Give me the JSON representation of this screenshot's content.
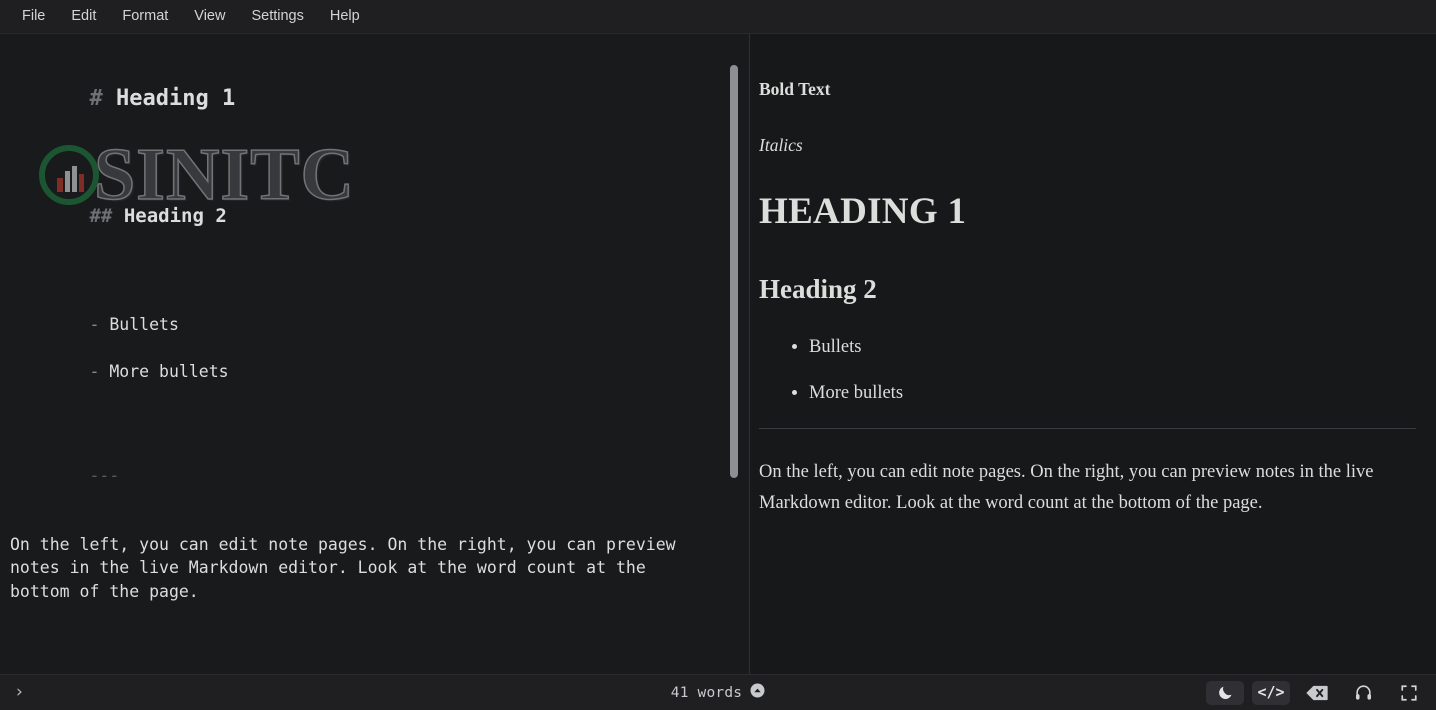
{
  "menubar": {
    "items": [
      {
        "label": "File",
        "name": "menu-file"
      },
      {
        "label": "Edit",
        "name": "menu-edit"
      },
      {
        "label": "Format",
        "name": "menu-format"
      },
      {
        "label": "View",
        "name": "menu-view"
      },
      {
        "label": "Settings",
        "name": "menu-settings"
      },
      {
        "label": "Help",
        "name": "menu-help"
      }
    ]
  },
  "editor": {
    "h1_mark": "#",
    "h1_text": "Heading 1",
    "h2_mark": "##",
    "h2_text": "Heading 2",
    "bullet_mark_1": "-",
    "bullet_text_1": "Bullets",
    "bullet_mark_2": "-",
    "bullet_text_2": "More bullets",
    "hr": "---",
    "paragraph": "On the left, you can edit note pages. On the right, you can preview notes in the live Markdown editor. Look at the word count at the bottom of the page."
  },
  "preview": {
    "bold_text": "Bold Text",
    "italic_text": "Italics",
    "heading1": "Heading 1",
    "heading2": "Heading 2",
    "bullets": [
      "Bullets",
      "More bullets"
    ],
    "paragraph": "On the left, you can edit note pages. On the right, you can preview notes in the live Markdown editor. Look at the word count at the bottom of the page."
  },
  "watermark": {
    "word": "SINITC",
    "logo_icon": "bar-chart-circle-logo",
    "ring_color": "#1f7a3f",
    "bar_color_accent": "#c0392b"
  },
  "statusbar": {
    "left_icon": "chevron-right-icon",
    "left_icon_glyph": "›",
    "word_count": "41 words",
    "word_count_icon": "chevron-up-circle-icon",
    "buttons": [
      {
        "name": "dark-mode-button",
        "icon": "moon-icon",
        "active": true
      },
      {
        "name": "source-code-button",
        "icon": "code-icon",
        "label": "</>",
        "active": true
      },
      {
        "name": "backspace-button",
        "icon": "backspace-delete-icon",
        "active": false
      },
      {
        "name": "audio-button",
        "icon": "headphones-icon",
        "active": false
      },
      {
        "name": "fullscreen-button",
        "icon": "fullscreen-icon",
        "active": false
      }
    ]
  },
  "colors": {
    "app_background": "#1b1b1d",
    "editor_background": "#191a1c",
    "preview_background": "#17181a",
    "menubar_background": "#1f1f21",
    "text_primary": "#ddddde",
    "scrollbar_thumb": "#8e8f94"
  }
}
